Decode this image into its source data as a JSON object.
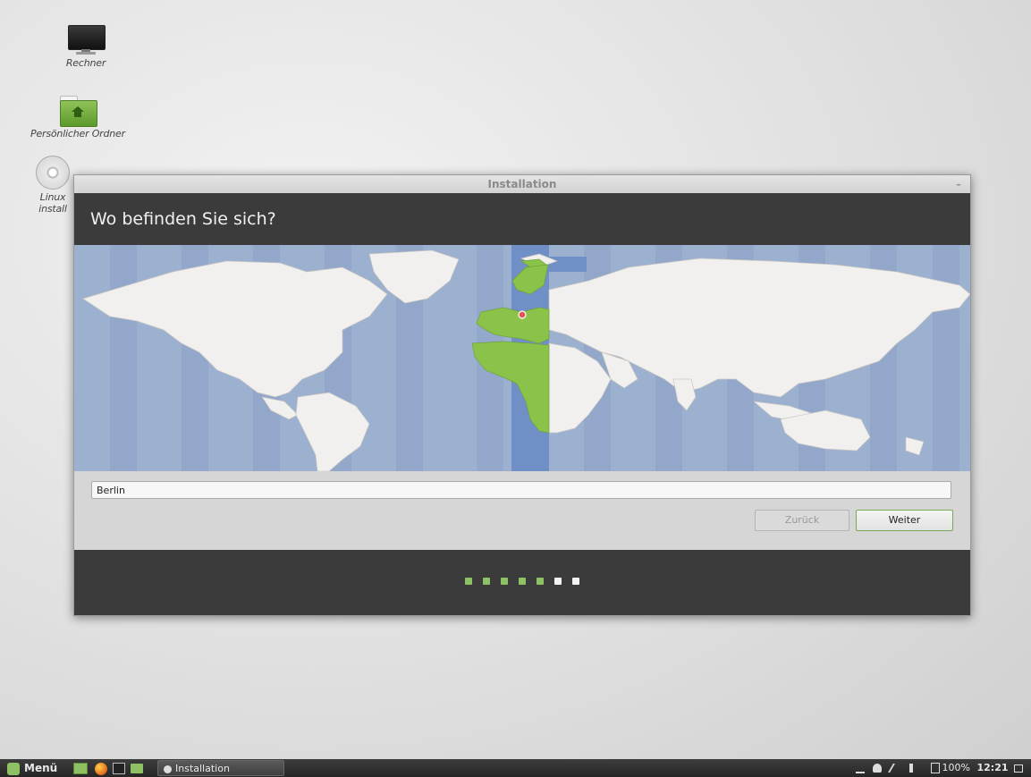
{
  "desktop": {
    "icons": [
      {
        "label": "Rechner",
        "icon": "computer-icon"
      },
      {
        "label": "Persönlicher Ordner",
        "icon": "home-folder-icon"
      },
      {
        "label": "Linux install",
        "icon": "disc-icon"
      }
    ]
  },
  "window": {
    "title": "Installation",
    "minimize_label": "–",
    "heading": "Wo befinden Sie sich?",
    "location_value": "Berlin",
    "back_label": "Zurück",
    "next_label": "Weiter",
    "progress": {
      "total_steps": 7,
      "completed_steps": 5
    },
    "colors": {
      "selected_zone": "#7fa0cf",
      "highlight_land": "#8bc34a",
      "ocean": "#9cb0cf",
      "dot_done": "#8fc064",
      "dot_todo": "#f2f2f2"
    }
  },
  "taskbar": {
    "menu_label": "Menü",
    "task_label": "Installation",
    "battery": "100%",
    "time": "12:21"
  }
}
